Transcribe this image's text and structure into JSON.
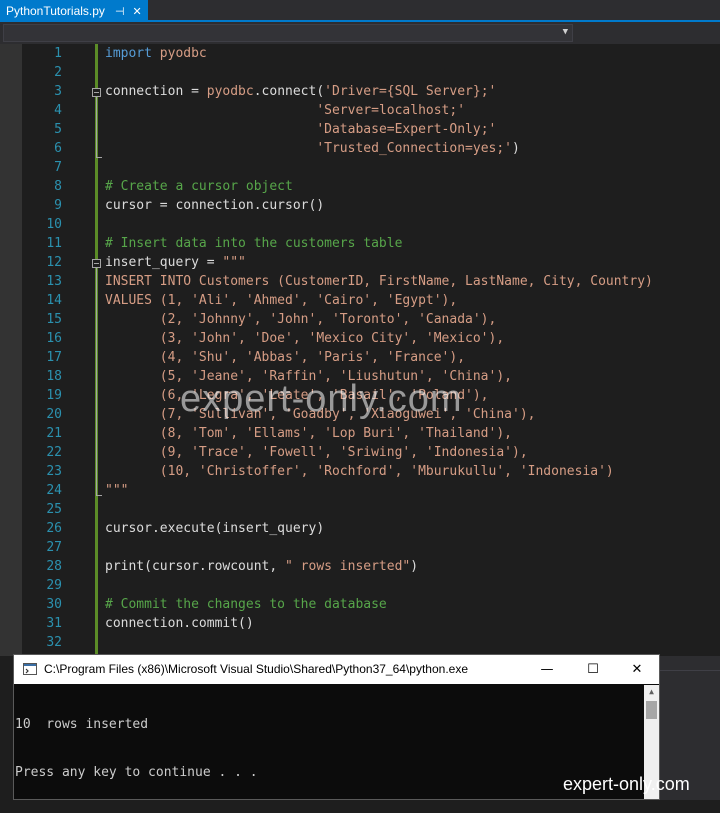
{
  "tab": {
    "title": "PythonTutorials.py",
    "pin_glyph": "⊣",
    "close_glyph": "✕"
  },
  "editor": {
    "lines": [
      {
        "n": "1",
        "segs": [
          [
            "kw",
            "import "
          ],
          [
            "str",
            "pyodbc"
          ]
        ]
      },
      {
        "n": "2",
        "segs": []
      },
      {
        "n": "3",
        "segs": [
          [
            "fn",
            "connection = "
          ],
          [
            "str",
            "pyodbc"
          ],
          [
            "fn",
            ".connect("
          ],
          [
            "str",
            "'Driver={SQL Server};'"
          ]
        ]
      },
      {
        "n": "4",
        "segs": [
          [
            "fn",
            "                           "
          ],
          [
            "str",
            "'Server=localhost;'"
          ]
        ]
      },
      {
        "n": "5",
        "segs": [
          [
            "fn",
            "                           "
          ],
          [
            "str",
            "'Database=Expert-Only;'"
          ]
        ]
      },
      {
        "n": "6",
        "segs": [
          [
            "fn",
            "                           "
          ],
          [
            "str",
            "'Trusted_Connection=yes;'"
          ],
          [
            "fn",
            ")"
          ]
        ]
      },
      {
        "n": "7",
        "segs": []
      },
      {
        "n": "8",
        "segs": [
          [
            "cm",
            "# Create a cursor object"
          ]
        ]
      },
      {
        "n": "9",
        "segs": [
          [
            "fn",
            "cursor = connection.cursor()"
          ]
        ]
      },
      {
        "n": "10",
        "segs": []
      },
      {
        "n": "11",
        "segs": [
          [
            "cm",
            "# Insert data into the customers table"
          ]
        ]
      },
      {
        "n": "12",
        "segs": [
          [
            "fn",
            "insert_query = "
          ],
          [
            "str",
            "\"\"\""
          ]
        ]
      },
      {
        "n": "13",
        "segs": [
          [
            "str",
            "INSERT INTO Customers (CustomerID, FirstName, LastName, City, Country)"
          ]
        ]
      },
      {
        "n": "14",
        "segs": [
          [
            "str",
            "VALUES (1, 'Ali', 'Ahmed', 'Cairo', 'Egypt'),"
          ]
        ]
      },
      {
        "n": "15",
        "segs": [
          [
            "str",
            "       (2, 'Johnny', 'John', 'Toronto', 'Canada'),"
          ]
        ]
      },
      {
        "n": "16",
        "segs": [
          [
            "str",
            "       (3, 'John', 'Doe', 'Mexico City', 'Mexico'),"
          ]
        ]
      },
      {
        "n": "17",
        "segs": [
          [
            "str",
            "       (4, 'Shu', 'Abbas', 'Paris', 'France'),"
          ]
        ]
      },
      {
        "n": "18",
        "segs": [
          [
            "str",
            "       (5, 'Jeane', 'Raffin', 'Liushutun', 'China'),"
          ]
        ]
      },
      {
        "n": "19",
        "segs": [
          [
            "str",
            "       (6, 'Legra', 'Leate', 'Basail', 'Poland'),"
          ]
        ]
      },
      {
        "n": "20",
        "segs": [
          [
            "str",
            "       (7, 'Sullivan', 'Goadby', 'Xiaoguwei', 'China'),"
          ]
        ]
      },
      {
        "n": "21",
        "segs": [
          [
            "str",
            "       (8, 'Tom', 'Ellams', 'Lop Buri', 'Thailand'),"
          ]
        ]
      },
      {
        "n": "22",
        "segs": [
          [
            "str",
            "       (9, 'Trace', 'Fowell', 'Sriwing', 'Indonesia'),"
          ]
        ]
      },
      {
        "n": "23",
        "segs": [
          [
            "str",
            "       (10, 'Christoffer', 'Rochford', 'Mburukullu', 'Indonesia')"
          ]
        ]
      },
      {
        "n": "24",
        "segs": [
          [
            "str",
            "\"\"\""
          ]
        ]
      },
      {
        "n": "25",
        "segs": []
      },
      {
        "n": "26",
        "segs": [
          [
            "fn",
            "cursor.execute(insert_query)"
          ]
        ]
      },
      {
        "n": "27",
        "segs": []
      },
      {
        "n": "28",
        "segs": [
          [
            "fn",
            "print(cursor.rowcount, "
          ],
          [
            "str",
            "\" rows inserted\""
          ],
          [
            "fn",
            ")"
          ]
        ]
      },
      {
        "n": "29",
        "segs": []
      },
      {
        "n": "30",
        "segs": [
          [
            "cm",
            "# Commit the changes to the database"
          ]
        ]
      },
      {
        "n": "31",
        "segs": [
          [
            "fn",
            "connection.commit()"
          ]
        ]
      },
      {
        "n": "32",
        "segs": []
      }
    ]
  },
  "watermark": {
    "middle": "expert-only.com",
    "corner": "expert-only.com"
  },
  "console": {
    "title": "C:\\Program Files (x86)\\Microsoft Visual Studio\\Shared\\Python37_64\\python.exe",
    "minimize_glyph": "—",
    "maximize_glyph": "☐",
    "close_glyph": "✕",
    "output_lines": [
      "10  rows inserted",
      "Press any key to continue . . ."
    ]
  },
  "colors": {
    "accent": "#007acc",
    "keyword": "#569cd6",
    "string": "#d69d85",
    "comment": "#57a64a",
    "line_number": "#2b91af"
  }
}
